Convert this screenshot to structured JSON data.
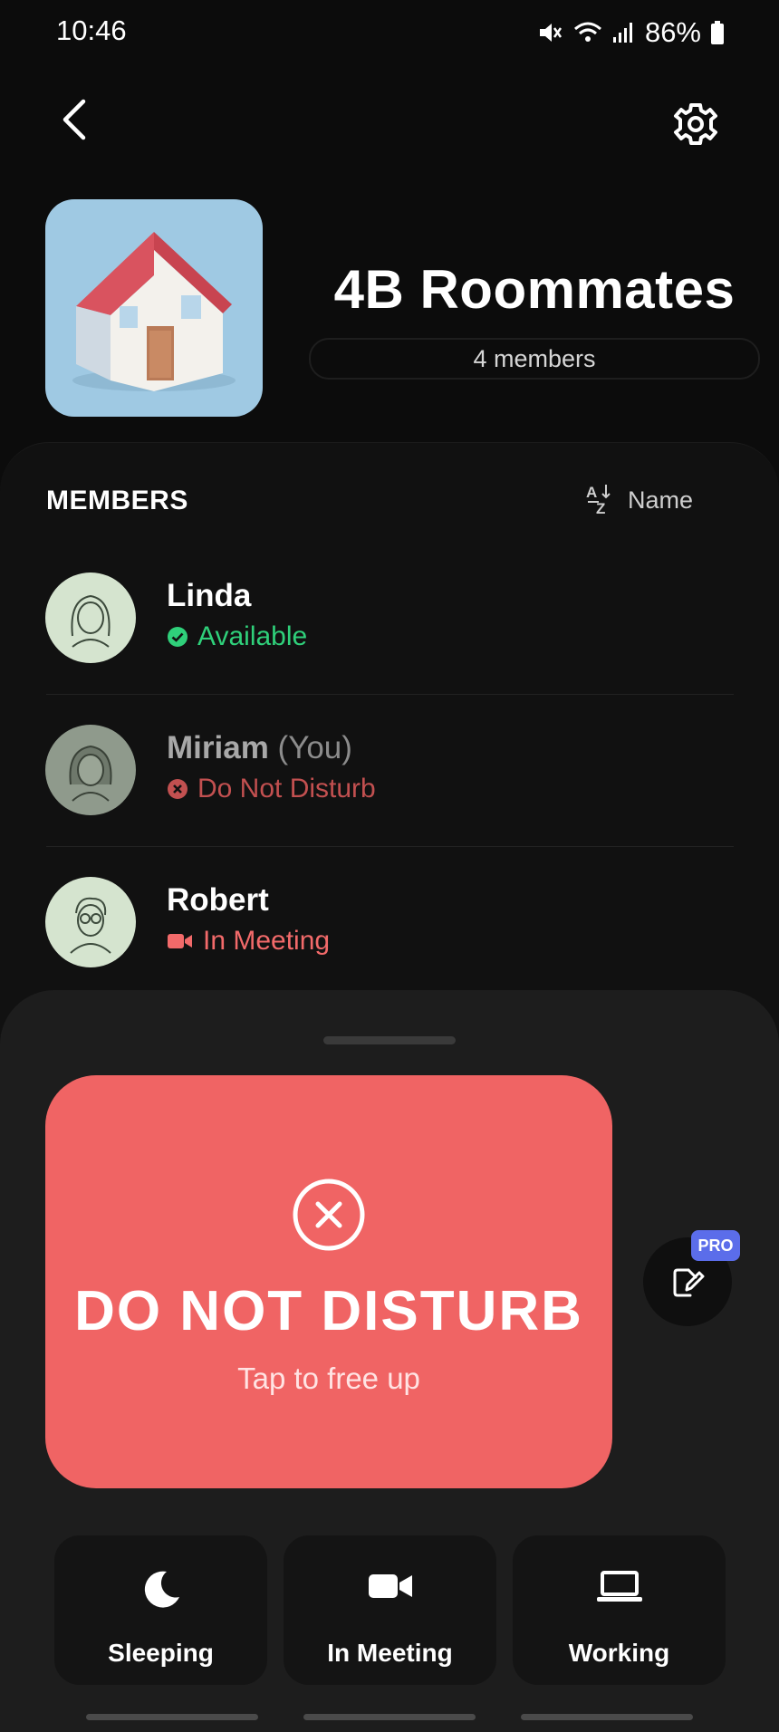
{
  "status_bar": {
    "time": "10:46",
    "battery": "86%"
  },
  "header": {
    "back_icon": "chevron-left-icon",
    "settings_icon": "gear-icon"
  },
  "group": {
    "name": "4B Roommates",
    "member_count": "4 members",
    "image_icon": "house-icon"
  },
  "members_section": {
    "heading": "MEMBERS",
    "sort_label": "Name",
    "members": [
      {
        "name": "Linda",
        "suffix": "",
        "status": "Available",
        "status_color": "#2fd07a"
      },
      {
        "name": "Miriam",
        "suffix": "(You)",
        "status": "Do Not Disturb",
        "status_color": "#e05454"
      },
      {
        "name": "Robert",
        "suffix": "",
        "status": "In Meeting",
        "status_color": "#f26a6a"
      }
    ]
  },
  "current_status": {
    "title": "DO NOT DISTURB",
    "subtitle": "Tap to free up",
    "color": "#f06464"
  },
  "pro_badge": "PRO",
  "quick_actions": [
    {
      "label": "Sleeping",
      "icon": "moon-icon"
    },
    {
      "label": "In Meeting",
      "icon": "video-camera-icon"
    },
    {
      "label": "Working",
      "icon": "laptop-icon"
    }
  ]
}
